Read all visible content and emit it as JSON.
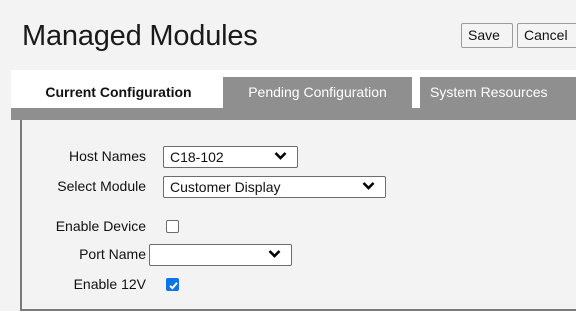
{
  "page": {
    "title": "Managed Modules"
  },
  "header": {
    "save_label": "Save",
    "cancel_label": "Cancel"
  },
  "tabs": [
    {
      "label": "Current Configuration",
      "active": true
    },
    {
      "label": "Pending Configuration",
      "active": false
    },
    {
      "label": "System Resources",
      "active": false
    }
  ],
  "form": {
    "host_names": {
      "label": "Host Names",
      "value": "C18-102"
    },
    "select_module": {
      "label": "Select Module",
      "value": "Customer Display"
    },
    "enable_device": {
      "label": "Enable Device",
      "checked": false
    },
    "port_name": {
      "label": "Port Name",
      "value": ""
    },
    "enable_12v": {
      "label": "Enable 12V",
      "checked": true
    }
  },
  "colors": {
    "checkbox_accent": "#0b74e8",
    "inactive_tab": "#8f8f8f"
  },
  "icons": {
    "dropdown": "chevron-down-icon",
    "check": "checkmark-icon"
  }
}
